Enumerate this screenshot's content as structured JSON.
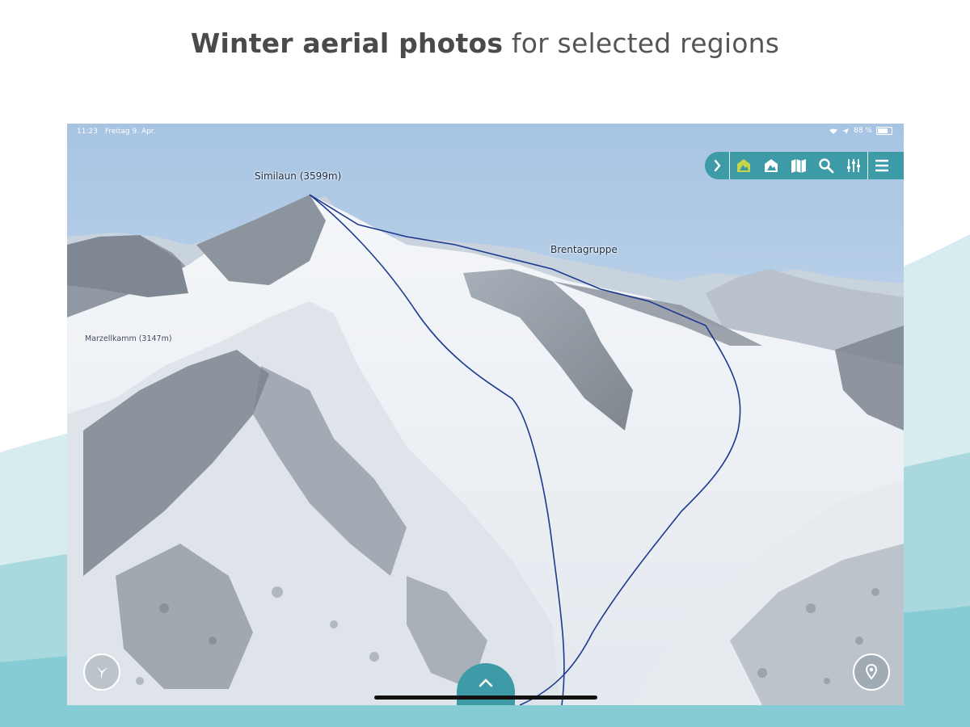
{
  "headline": {
    "bold": "Winter aerial photos",
    "rest": " for selected regions"
  },
  "status_bar": {
    "time": "11:23",
    "date": "Freitag 9. Apr.",
    "battery": "88 %"
  },
  "map_labels": {
    "peak": "Similaun (3599m)",
    "range": "Brentagruppe",
    "side_peak": "Marzellkamm (3147m)"
  },
  "toolbar": {
    "items": [
      "collapse",
      "winter-layer",
      "layers",
      "map",
      "search",
      "settings",
      "menu"
    ]
  },
  "colors": {
    "accent": "#3d9ba8",
    "route": "#1d3a8f"
  }
}
